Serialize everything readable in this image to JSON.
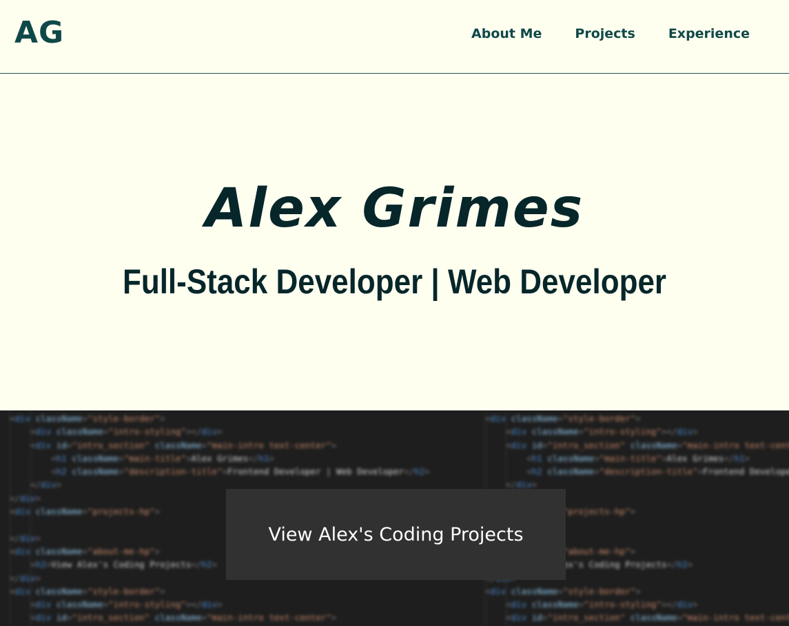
{
  "nav": {
    "logo": "AG",
    "links": [
      {
        "label": "About Me"
      },
      {
        "label": "Projects"
      },
      {
        "label": "Experience"
      }
    ]
  },
  "hero": {
    "title": "Alex Grimes",
    "subtitle": "Full-Stack Developer | Web Developer"
  },
  "cta": {
    "label": "View Alex's Coding Projects"
  },
  "colors": {
    "page_background": "#fffff0",
    "brand_teal": "#0f4848",
    "hero_text": "#06262a",
    "code_background": "#1e1e1e",
    "button_background": "#313131"
  }
}
